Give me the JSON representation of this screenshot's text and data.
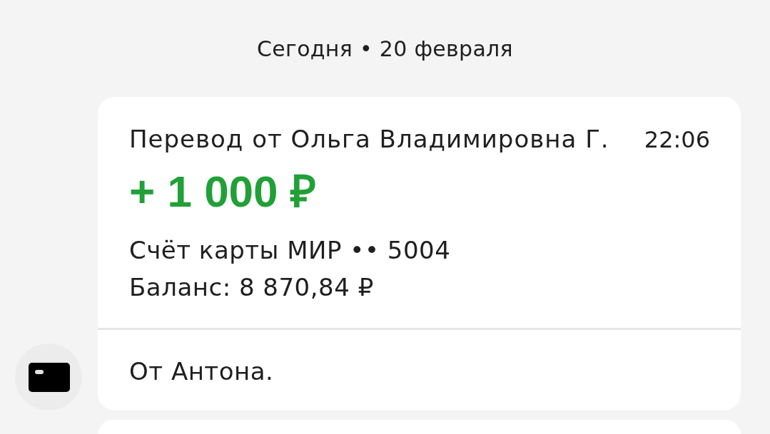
{
  "date_header": "Сегодня • 20 февраля",
  "messages": [
    {
      "title": "Перевод от Ольга Владимировна Г.",
      "time": "22:06",
      "amount": "+ 1 000 ₽",
      "account": "Счёт карты МИР •• 5004",
      "balance": "Баланс: 8 870,84 ₽",
      "comment": "От Антона."
    }
  ]
}
